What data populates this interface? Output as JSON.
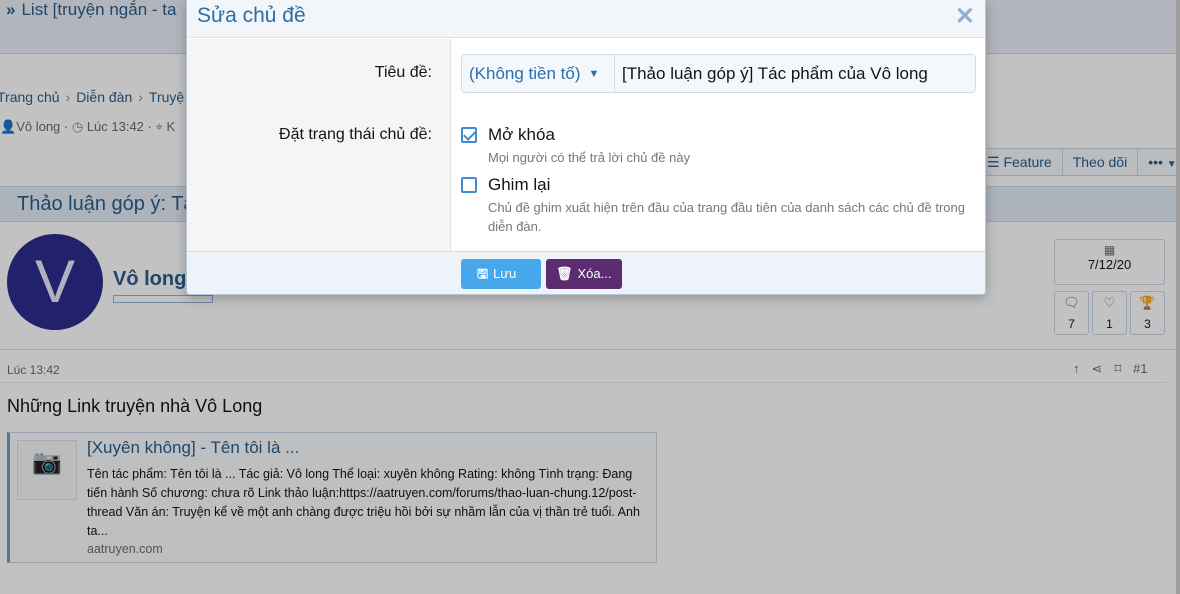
{
  "background": {
    "topbar_title": "List [truyện ngắn - ta",
    "breadcrumb": [
      "Trang chủ",
      "Diễn đàn",
      "Truyệ"
    ],
    "meta": {
      "author": "Vô long",
      "time": "Lúc 13:42",
      "tag": "K"
    },
    "thread_buttons": {
      "feature": "Feature",
      "follow": "Theo dõi",
      "more": "•••"
    },
    "thread_title": "Thảo luận góp ý: Tá",
    "user": {
      "avatar_letter": "V",
      "name": "Vô long"
    },
    "stats": {
      "date": "7/12/20",
      "posts": "7",
      "likes": "1",
      "trophies": "3"
    },
    "post": {
      "time": "Lúc 13:42",
      "number": "#1",
      "body": "Những Link truyện nhà Vô Long",
      "unfurl": {
        "title": "[Xuyên không] - Tên tôi là ...",
        "description": "Tên tác phẩm: Tên tôi là ... Tác giả: Vô long Thể loại: xuyên không Rating: không Tình trạng: Đang tiến hành Số chương: chưa rõ Link thảo luận:https://aatruyen.com/forums/thao-luan-chung.12/post-thread Văn án: Truyện kể về một anh chàng được triệu hồi bởi sự nhầm lẫn của vị thần trẻ tuổi. Anh ta...",
        "domain": "aatruyen.com"
      }
    }
  },
  "modal": {
    "title": "Sửa chủ đề",
    "title_label": "Tiêu đề:",
    "prefix": "(Không tiền tố)",
    "title_value": "[Thảo luận góp ý] Tác phẩm của Vô long",
    "status_label": "Đặt trạng thái chủ đề:",
    "options": [
      {
        "label": "Mở khóa",
        "hint": "Mọi người có thể trả lời chủ đề này",
        "checked": true
      },
      {
        "label": "Ghim lại",
        "hint": "Chủ đề ghim xuất hiện trên đầu của trang đầu tiên của danh sách các chủ đề trong diễn đàn.",
        "checked": false
      }
    ],
    "save_label": "Lưu",
    "delete_label": "Xóa..."
  }
}
